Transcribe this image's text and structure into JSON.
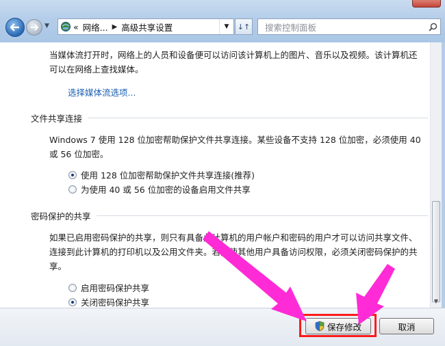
{
  "nav": {
    "breadcrumb": [
      "网络...",
      "高级共享设置"
    ],
    "breadcrumb_overflow": "«",
    "search_placeholder": "搜索控制面板"
  },
  "content": {
    "media_text": "当媒体流打开时，网络上的人员和设备便可以访问该计算机上的图片、音乐以及视频。该计算机还可以在网络上查找媒体。",
    "media_link": "选择媒体流选项...",
    "file_sharing": {
      "title": "文件共享连接",
      "description": "Windows 7 使用 128 位加密帮助保护文件共享连接。某些设备不支持 128 位加密，必须使用 40 或 56 位加密。",
      "options": [
        {
          "label": "使用 128 位加密帮助保护文件共享连接(推荐)",
          "selected": true
        },
        {
          "label": "为使用 40 或 56 位加密的设备启用文件共享",
          "selected": false
        }
      ]
    },
    "password_sharing": {
      "title": "密码保护的共享",
      "description": "如果已启用密码保护的共享，则只有具备此计算机的用户帐户和密码的用户才可以访问共享文件、连接到此计算机的打印机以及公用文件夹。若要使其他用户具备访问权限，必须关闭密码保护的共享。",
      "options": [
        {
          "label": "启用密码保护共享",
          "selected": false
        },
        {
          "label": "关闭密码保护共享",
          "selected": true
        }
      ]
    }
  },
  "buttons": {
    "save": "保存修改",
    "cancel": "取消"
  },
  "colors": {
    "link": "#1a5fb4",
    "highlight": "#ff1a1a",
    "arrow": "#ff2bd6"
  }
}
